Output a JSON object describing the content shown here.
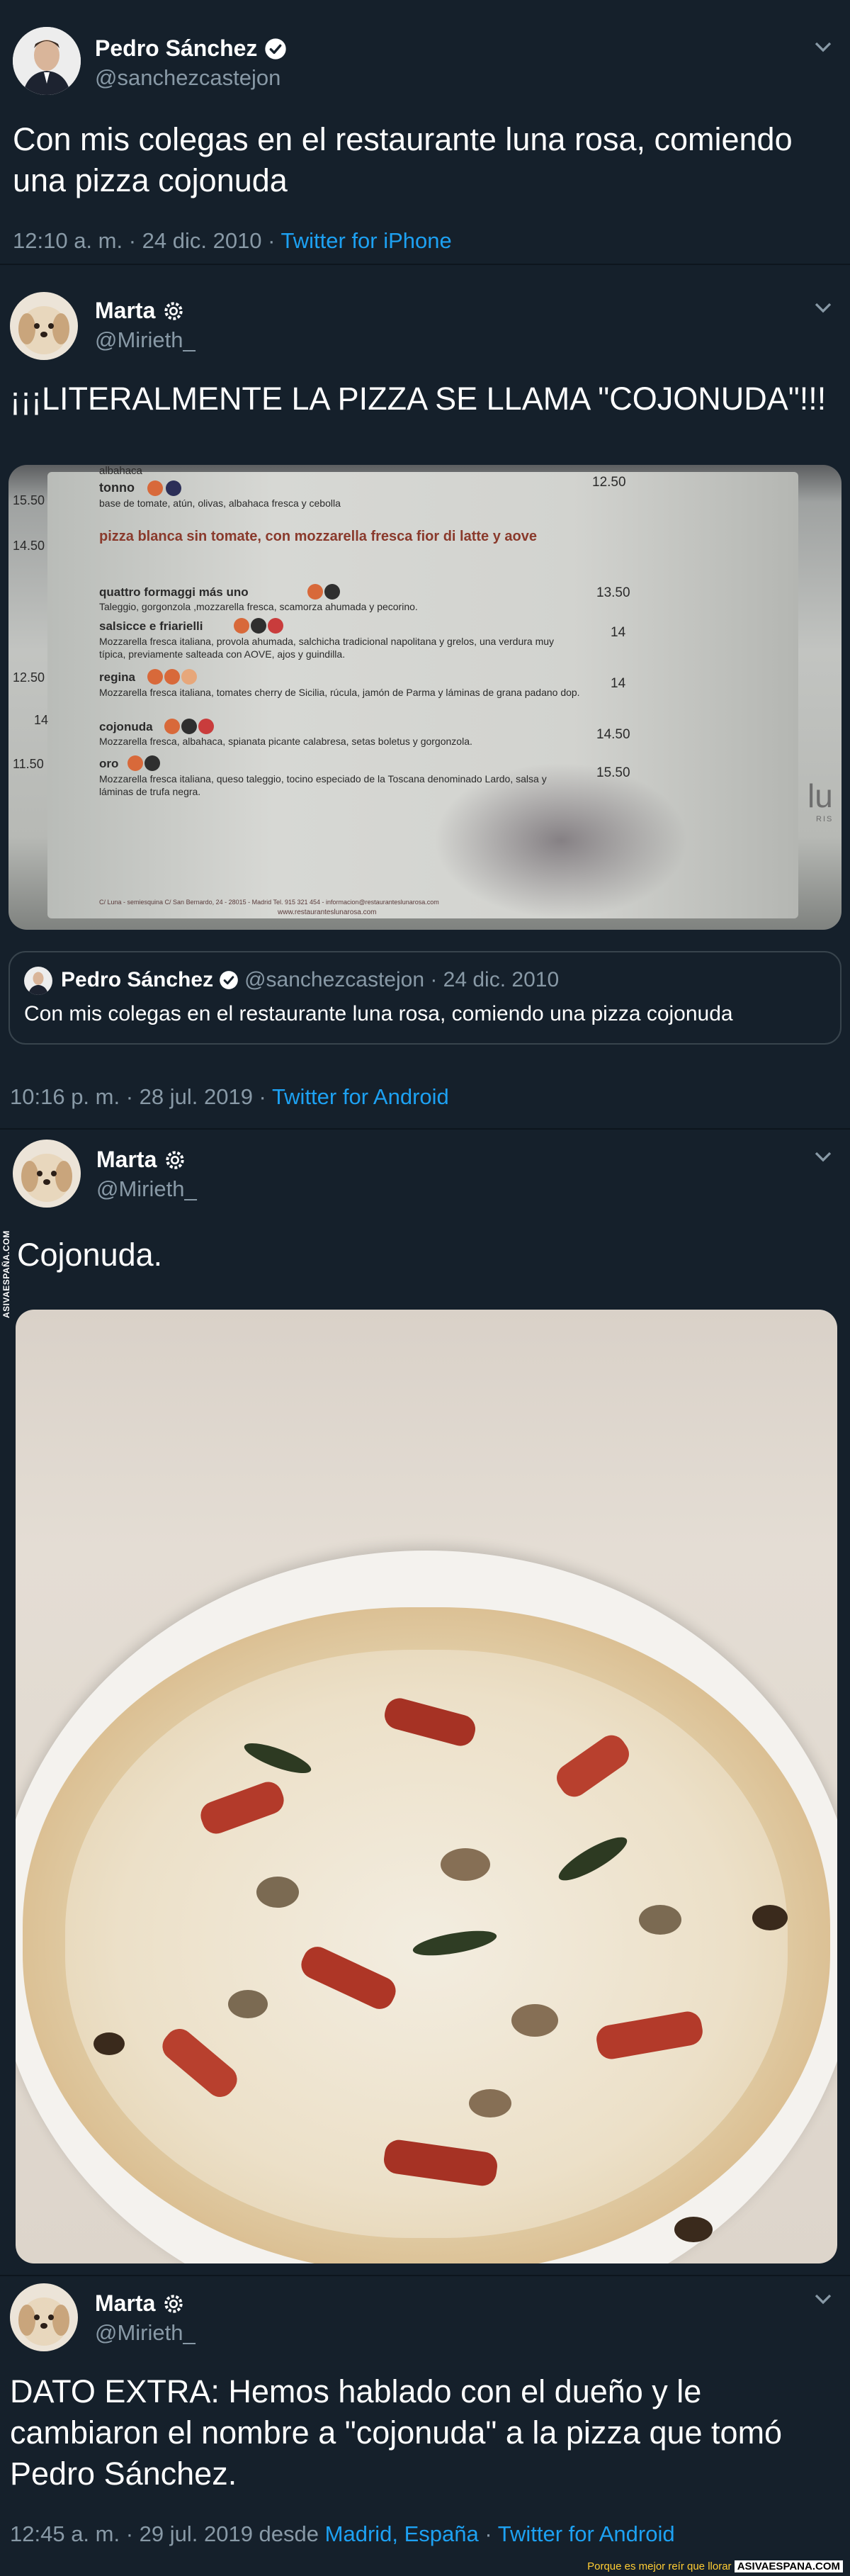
{
  "tweet1": {
    "name": "Pedro Sánchez",
    "handle": "@sanchezcastejon",
    "text": "Con mis colegas en el restaurante luna rosa, comiendo una pizza cojonuda",
    "time": "12:10 a. m. · 24 dic. 2010 · ",
    "source": "Twitter for iPhone"
  },
  "tweet2": {
    "name": "Marta",
    "handle": "@Mirieth_",
    "text": "¡¡¡LITERALMENTE LA PIZZA SE LLAMA \"COJONUDA\"!!!",
    "menu": {
      "line1": "albahaca",
      "line2": "tonno",
      "line3": "base de tomate, atún, olivas, albahaca fresca y cebolla",
      "price_a": "12.50",
      "price_left1": "15.50",
      "heading": "pizza blanca sin tomate, con mozzarella fresca fior di latte y aove",
      "price_left2": "14.50",
      "items": [
        {
          "name": "quattro formaggi más uno",
          "desc": "Taleggio, gorgonzola ,mozzarella fresca, scamorza ahumada y pecorino.",
          "price": "13.50"
        },
        {
          "name": "salsicce e friarielli",
          "desc": "Mozzarella fresca italiana, provola ahumada, salchicha tradicional napolitana y grelos, una verdura muy típica, previamente salteada con AOVE, ajos y guindilla.",
          "price": "14"
        },
        {
          "name": "regina",
          "desc": "Mozzarella fresca italiana, tomates cherry de Sicilia, rúcula, jamón de Parma y láminas de grana padano dop.",
          "price": "14"
        },
        {
          "name": "cojonuda",
          "desc": "Mozzarella fresca, albahaca, spianata picante calabresa, setas boletus y gorgonzola.",
          "price": "14.50"
        },
        {
          "name": "oro",
          "desc": "Mozzarella fresca italiana, queso taleggio, tocino especiado de la Toscana denominado Lardo, salsa y láminas de trufa negra.",
          "price": "15.50"
        }
      ],
      "price_left3": "12.50",
      "price_left4": "14",
      "price_left5": "11.50",
      "footer": "C/ Luna - semiesquina C/ San Bernardo, 24 - 28015 - Madrid Tel. 915 321 454 - informacion@restauranteslunarosa.com",
      "website": "www.restauranteslunarosa.com",
      "brand_fragment": "lu",
      "brand_sub": "RIS"
    },
    "quote": {
      "name": "Pedro Sánchez",
      "handle": "@sanchezcastejon · 24 dic. 2010",
      "text": "Con mis colegas en el restaurante luna rosa, comiendo una pizza cojonuda"
    },
    "time": "10:16 p. m. · 28 jul. 2019 · ",
    "source": "Twitter for Android"
  },
  "tweet3": {
    "name": "Marta",
    "handle": "@Mirieth_",
    "text": "Cojonuda.",
    "side_watermark": "ASIVAESPAÑA.COM"
  },
  "tweet4": {
    "name": "Marta",
    "handle": "@Mirieth_",
    "text": "DATO EXTRA: Hemos hablado con el dueño y le cambiaron el nombre a \"cojonuda\" a la pizza que tomó Pedro Sánchez.",
    "time": "12:45 a. m. · 29 jul. 2019 desde ",
    "location": "Madrid, España",
    "separator": " · ",
    "source": "Twitter for Android"
  },
  "footer": {
    "tagline": "Porque es mejor reír que llorar ",
    "brand": "ASIVAESPANA.COM"
  },
  "colors": {
    "background": "#15202b",
    "secondary_text": "#8899a6",
    "link": "#1da1f2",
    "border": "#38444d"
  }
}
